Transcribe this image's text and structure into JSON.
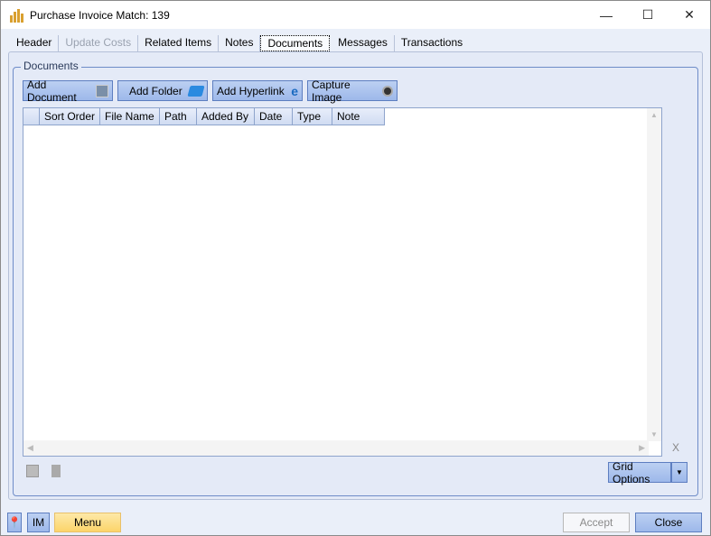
{
  "window": {
    "title": "Purchase Invoice Match: 139",
    "minimize": "—",
    "maximize": "☐",
    "close": "✕"
  },
  "tabs": [
    {
      "label": "Header"
    },
    {
      "label": "Update Costs"
    },
    {
      "label": "Related Items"
    },
    {
      "label": "Notes"
    },
    {
      "label": "Documents"
    },
    {
      "label": "Messages"
    },
    {
      "label": "Transactions"
    }
  ],
  "documents": {
    "group_label": "Documents",
    "toolbar": {
      "add_document": "Add Document",
      "add_folder": "Add Folder",
      "add_hyperlink": "Add Hyperlink",
      "capture_image": "Capture Image"
    },
    "columns": [
      "Sort Order",
      "File Name",
      "Path",
      "Added By",
      "Date",
      "Type",
      "Note"
    ],
    "clear_label": "X",
    "grid_options": "Grid Options"
  },
  "footer": {
    "im": "IM",
    "menu": "Menu",
    "accept": "Accept",
    "close": "Close"
  }
}
